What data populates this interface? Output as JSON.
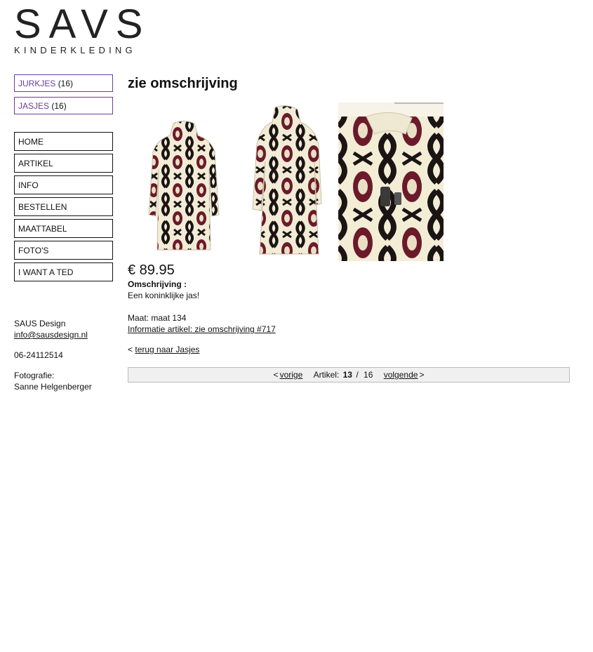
{
  "logo": {
    "main": "SAVS",
    "sub": "KINDERKLEDING"
  },
  "categories": [
    {
      "label": "JURKJES",
      "count": "(16)"
    },
    {
      "label": "JASJES",
      "count": "(16)"
    }
  ],
  "nav": [
    "HOME",
    "ARTIKEL",
    "INFO",
    "BESTELLEN",
    "MAATTABEL",
    "FOTO'S",
    "I WANT A TED"
  ],
  "contact": {
    "company": "SAUS Design",
    "email": "info@sausdesign.nl",
    "phone": "06-24112514",
    "photo_label": "Fotografie:",
    "photographer": "Sanne Helgenberger"
  },
  "product": {
    "title": "zie omschrijving",
    "price": "€ 89.95",
    "desc_label": "Omschrijving :",
    "desc_text": "Een koninklijke jas!",
    "size": "Maat: maat 134",
    "info_link": "Informatie artikel: zie omschrijving #717"
  },
  "back": {
    "prefix": "<",
    "link": "terug naar Jasjes"
  },
  "pager": {
    "prev_prefix": "<",
    "prev": "vorige",
    "label": "Artikel:",
    "current": "13",
    "sep": "/",
    "total": "16",
    "next": "volgende",
    "next_suffix": ">"
  },
  "colors": {
    "category_border": "#6a3d9a",
    "pager_bg": "#f0f0f0",
    "coat_cream": "#f2ecd7",
    "coat_maroon": "#6b1a2a",
    "coat_black": "#1b1414"
  },
  "icons": {
    "photo1": "coat-front-photo",
    "photo2": "coat-side-photo",
    "photo3": "coat-detail-photo"
  }
}
